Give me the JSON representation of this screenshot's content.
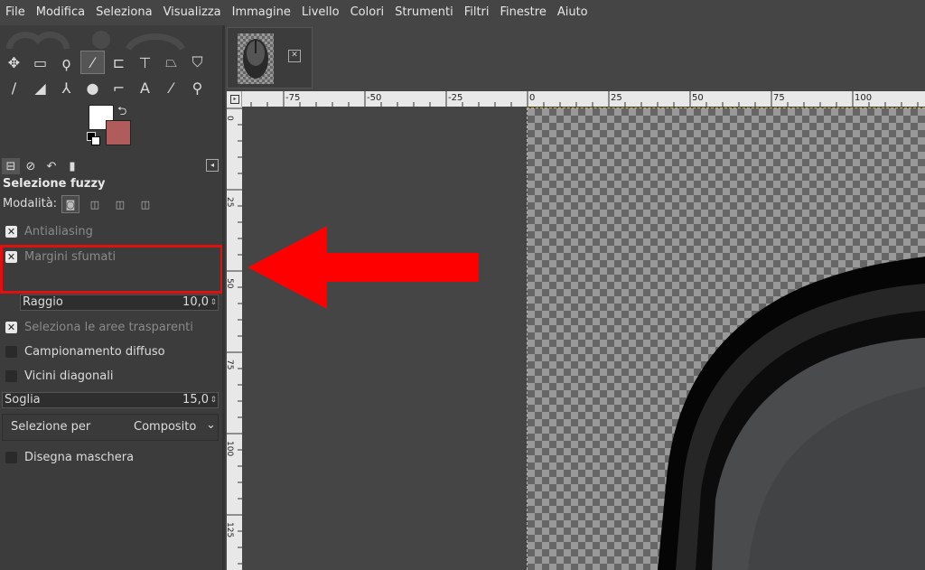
{
  "menubar": {
    "items": [
      "File",
      "Modifica",
      "Seleziona",
      "Visualizza",
      "Immagine",
      "Livello",
      "Colori",
      "Strumenti",
      "Filtri",
      "Finestre",
      "Aiuto"
    ]
  },
  "toolbox": {
    "tools": [
      {
        "name": "move-tool-icon",
        "glyph": "✥"
      },
      {
        "name": "rect-select-icon",
        "glyph": "▭"
      },
      {
        "name": "free-select-icon",
        "glyph": "ϙ"
      },
      {
        "name": "fuzzy-select-icon",
        "glyph": "⁄"
      },
      {
        "name": "crop-icon",
        "glyph": "⊏"
      },
      {
        "name": "unified-transform-icon",
        "glyph": "⊤"
      },
      {
        "name": "warp-transform-icon",
        "glyph": "⏢"
      },
      {
        "name": "bucket-fill-icon",
        "glyph": "⛉"
      },
      {
        "name": "paintbrush-icon",
        "glyph": "∕"
      },
      {
        "name": "eraser-icon",
        "glyph": "◢"
      },
      {
        "name": "clone-icon",
        "glyph": "⅄"
      },
      {
        "name": "smudge-icon",
        "glyph": "●"
      },
      {
        "name": "paths-icon",
        "glyph": "⌐"
      },
      {
        "name": "text-tool-icon",
        "glyph": "A"
      },
      {
        "name": "color-picker-icon",
        "glyph": "⁄"
      },
      {
        "name": "zoom-icon",
        "glyph": "⚲"
      }
    ],
    "active_tool_index": 3,
    "foreground_color": "#ffffff",
    "background_color": "#b05c5c"
  },
  "tool_options": {
    "title": "Selezione fuzzy",
    "mode_label": "Modalità:",
    "antialiasing": {
      "label": "Antialiasing",
      "checked": true
    },
    "feather": {
      "label": "Margini sfumati",
      "checked": true
    },
    "radius": {
      "label": "Raggio",
      "value": "10,0"
    },
    "select_transparent": {
      "label": "Seleziona le aree trasparenti",
      "checked": true
    },
    "sample_merged": {
      "label": "Campionamento diffuso",
      "checked": false
    },
    "diagonal": {
      "label": "Vicini diagonali",
      "checked": false
    },
    "threshold": {
      "label": "Soglia",
      "value": "15,0"
    },
    "select_by": {
      "label": "Selezione per",
      "value": "Composito"
    },
    "draw_mask": {
      "label": "Disegna maschera",
      "checked": false
    }
  },
  "ruler": {
    "h_labels": [
      "-75",
      "-50",
      "-25",
      "0",
      "25",
      "50",
      "75",
      "100"
    ],
    "v_labels": [
      "0",
      "25",
      "50",
      "75",
      "100",
      "125"
    ]
  },
  "colors": {
    "highlight": "#e01010",
    "arrow": "#ff0000"
  }
}
